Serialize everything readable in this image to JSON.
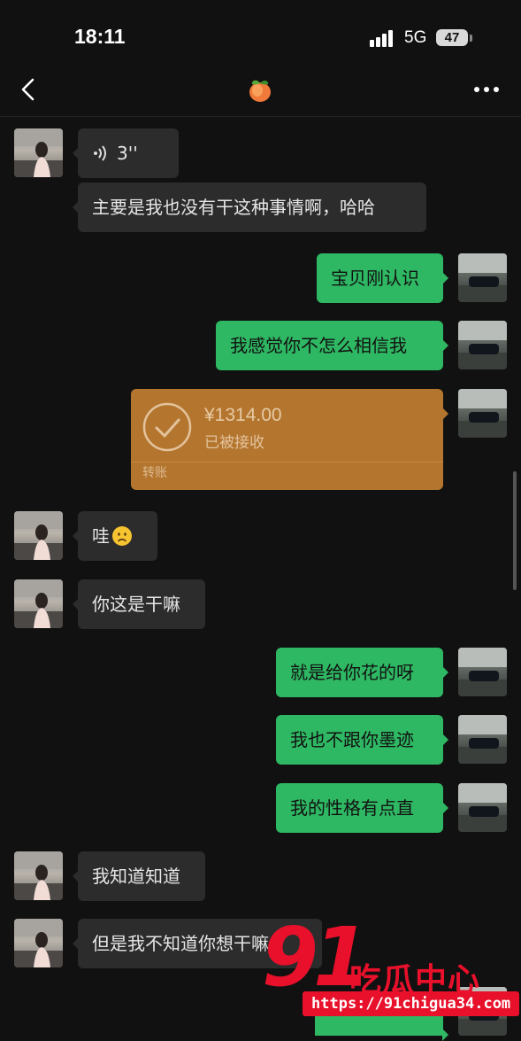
{
  "status_bar": {
    "time": "18:11",
    "network": "5G",
    "battery": "47"
  },
  "nav": {
    "title_icon": "peach-emoji-icon",
    "back_icon": "chevron-left-icon",
    "more_icon": "more-dots-icon"
  },
  "messages": [
    {
      "side": "in",
      "type": "voice",
      "duration": "3''"
    },
    {
      "side": "in",
      "type": "text",
      "text": "主要是我也没有干这种事情啊，哈哈"
    },
    {
      "side": "out",
      "type": "text",
      "text": "宝贝刚认识"
    },
    {
      "side": "out",
      "type": "text",
      "text": "我感觉你不怎么相信我"
    },
    {
      "side": "out",
      "type": "transfer",
      "amount": "¥1314.00",
      "status": "已被接收",
      "label": "转账"
    },
    {
      "side": "in",
      "type": "text",
      "text": "哇",
      "emoji": "worried-face-icon"
    },
    {
      "side": "in",
      "type": "text",
      "text": "你这是干嘛"
    },
    {
      "side": "out",
      "type": "text",
      "text": "就是给你花的呀"
    },
    {
      "side": "out",
      "type": "text",
      "text": "我也不跟你墨迹"
    },
    {
      "side": "out",
      "type": "text",
      "text": "我的性格有点直"
    },
    {
      "side": "in",
      "type": "text",
      "text": "我知道知道"
    },
    {
      "side": "in",
      "type": "text",
      "text": "但是我不知道你想干嘛"
    }
  ],
  "watermark": {
    "number": "91",
    "name": "吃瓜中心",
    "url": "https://91chigua34.com"
  },
  "colors": {
    "background": "#111111",
    "incoming_bubble": "#2c2c2c",
    "outgoing_bubble": "#2fb863",
    "transfer_card": "#b4762f",
    "watermark": "#e8102a"
  }
}
